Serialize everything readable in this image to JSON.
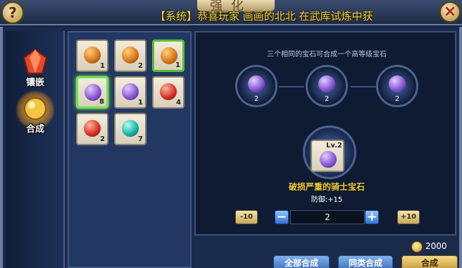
{
  "header": {
    "title": "强化",
    "system_message": "【系统】恭喜玩家 画画的北北 在武库试炼中获",
    "help_icon": "help-icon",
    "close_icon": "close-icon"
  },
  "sidebar": {
    "tabs": [
      {
        "label": "镶嵌",
        "icon": "ruby-gem-icon",
        "active": false
      },
      {
        "label": "合成",
        "icon": "gold-gem-icon",
        "active": true
      }
    ]
  },
  "inventory": {
    "slots": [
      {
        "color": "#d97a1e",
        "count": "1",
        "highlight": false
      },
      {
        "color": "#d97a1e",
        "count": "2",
        "highlight": false
      },
      {
        "color": "#d97a1e",
        "count": "1",
        "highlight": true
      },
      {
        "color": "#8b5bd6",
        "count": "8",
        "highlight": true
      },
      {
        "color": "#8b5bd6",
        "count": "1",
        "highlight": false
      },
      {
        "color": "#d9372a",
        "count": "4",
        "highlight": false
      },
      {
        "color": "#d9372a",
        "count": "2",
        "highlight": false
      },
      {
        "color": "#1fb8a8",
        "count": "7",
        "highlight": false
      }
    ]
  },
  "synthesis": {
    "hint": "三个相同的宝石可合成一个高等级宝石",
    "inputs": [
      {
        "count": "2",
        "color": "#8b5bd6"
      },
      {
        "count": "2",
        "color": "#8b5bd6"
      },
      {
        "count": "2",
        "color": "#8b5bd6"
      }
    ],
    "result": {
      "level": "Lv.2",
      "name": "破损严重的骑士宝石",
      "stat": "防御:+15",
      "color": "#8b5bd6"
    },
    "quantity": {
      "minus10_label": "-10",
      "plus10_label": "+10",
      "minus_label": "−",
      "plus_label": "+",
      "value": "2"
    }
  },
  "currency": {
    "icon": "gold-coin-icon",
    "value": "2000"
  },
  "buttons": {
    "all_label": "全部合成",
    "same_label": "同类合成",
    "synth_label": "合成"
  }
}
